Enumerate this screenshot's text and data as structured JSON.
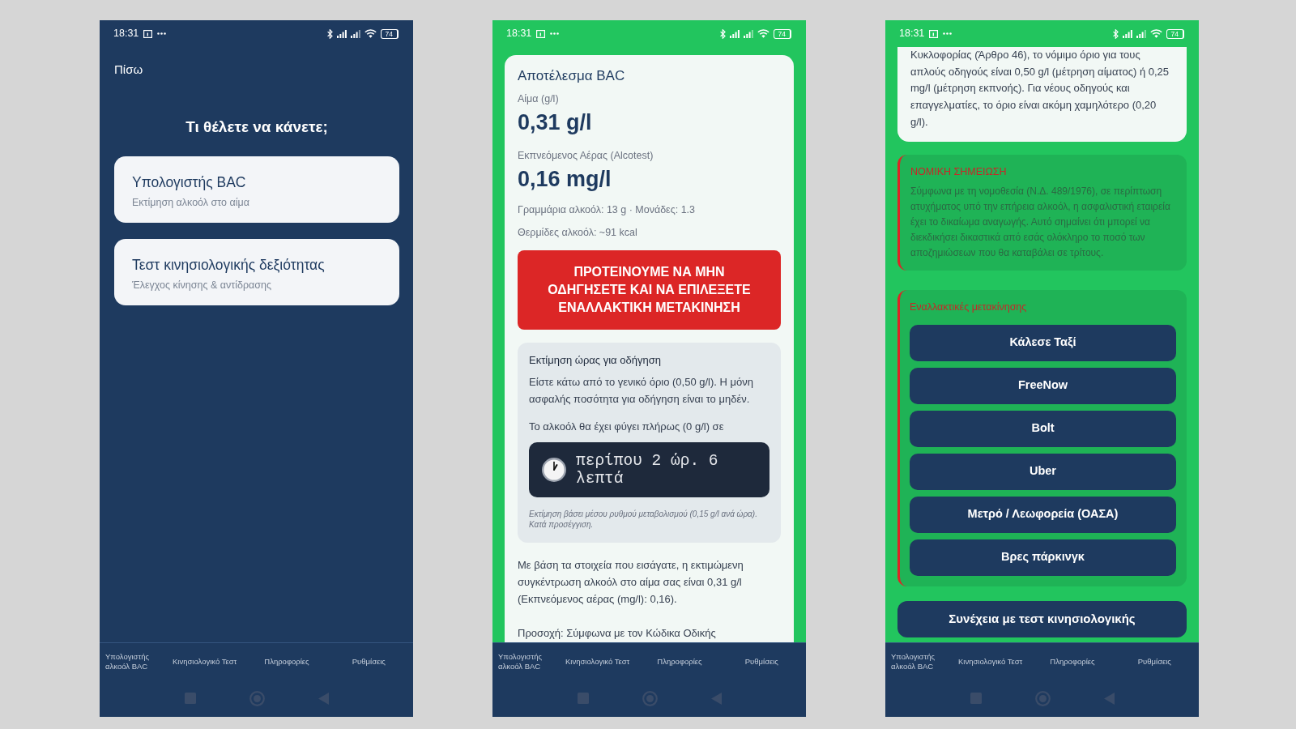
{
  "screens": [
    {
      "kind": "menu",
      "status_bar": {
        "time": "18:31",
        "battery": "74"
      },
      "blocks": [
        {
          "kind": "back_link",
          "text": "Πίσω"
        },
        {
          "kind": "heading",
          "text": "Τι θέλετε να κάνετε;"
        },
        {
          "kind": "option_card",
          "title": "Υπολογιστής BAC",
          "subtitle": "Εκτίμηση αλκοόλ στο αίμα"
        },
        {
          "kind": "option_card",
          "title": "Τεστ κινησιολογικής δεξιότητας",
          "subtitle": "Έλεγχος κίνησης & αντίδρασης"
        }
      ],
      "nav_tabs": [
        "Υπολογιστής αλκοόλ BAC",
        "Κινησιολογικό Τεστ",
        "Πληροφορίες",
        "Ρυθμίσεις"
      ]
    },
    {
      "kind": "result",
      "status_bar": {
        "time": "18:31",
        "battery": "74"
      },
      "blocks": [
        {
          "kind": "card",
          "items": [
            {
              "kind": "title",
              "text": "Αποτέλεσμα BAC"
            },
            {
              "kind": "label",
              "text": "Αίμα (g/l)"
            },
            {
              "kind": "value",
              "text": "0,31 g/l"
            },
            {
              "kind": "label",
              "text": "Εκπνεόμενος Αέρας (Alcotest)"
            },
            {
              "kind": "value",
              "text": "0,16 mg/l"
            },
            {
              "kind": "detail",
              "text": "Γραμμάρια αλκοόλ: 13 g · Μονάδες: 1.3"
            },
            {
              "kind": "detail",
              "text": "Θερμίδες αλκοόλ: ~91 kcal"
            },
            {
              "kind": "alert",
              "text": "ΠΡΟΤΕΙΝΟΥΜΕ ΝΑ ΜΗΝ ΟΔΗΓΗΣΕΤΕ ΚΑΙ ΝΑ ΕΠΙΛΕΞΕΤΕ ΕΝΑΛΛΑΚΤΙΚΗ ΜΕΤΑΚΙΝΗΣΗ"
            },
            {
              "kind": "estimate",
              "title": "Εκτίμηση ώρας για οδήγηση",
              "text": "Είστε κάτω από το γενικό όριο (0,50 g/l). Η μόνη ασφαλής ποσότητα για οδήγηση είναι το μηδέν.",
              "lead": "Το αλκοόλ θα έχει φύγει πλήρως (0 g/l) σε",
              "timer": "περίπου 2 ώρ. 6 λεπτά",
              "note": "Εκτίμηση βάσει μέσου ρυθμού μεταβολισμού (0,15 g/l ανά ώρα). Κατά προσέγγιση."
            },
            {
              "kind": "paragraph",
              "text": "Με βάση τα στοιχεία που εισάγατε, η εκτιμώμενη συγκέντρωση αλκοόλ στο αίμα σας είναι 0,31 g/l (Εκπνεόμενος αέρας (mg/l): 0,16)."
            },
            {
              "kind": "paragraph",
              "text": "Προσοχή: Σύμφωνα με τον Κώδικα Οδικής"
            }
          ]
        }
      ],
      "nav_tabs": [
        "Υπολογιστής αλκοόλ BAC",
        "Κινησιολογικό Τεστ",
        "Πληροφορίες",
        "Ρυθμίσεις"
      ]
    },
    {
      "kind": "result",
      "status_bar": {
        "time": "18:31",
        "battery": "74"
      },
      "blocks": [
        {
          "kind": "card_tail",
          "items": [
            {
              "kind": "paragraph",
              "text": "Κυκλοφορίας (Άρθρο 46), το νόμιμο όριο για τους απλούς οδηγούς είναι 0,50 g/l (μέτρηση αίματος) ή 0,25 mg/l (μέτρηση εκπνοής). Για νέους οδηγούς και επαγγελματίες, το όριο είναι ακόμη χαμηλότερο (0,20 g/l)."
            }
          ]
        },
        {
          "kind": "notice",
          "title": "ΝΟΜΙΚΗ ΣΗΜΕΙΩΣΗ",
          "text": "Σύμφωνα με τη νομοθεσία (Ν.Δ. 489/1976), σε περίπτωση ατυχήματος υπό την επήρεια αλκοόλ, η ασφαλιστική εταιρεία έχει το δικαίωμα αναγωγής. Αυτό σημαίνει ότι μπορεί να διεκδικήσει δικαστικά από εσάς ολόκληρο το ποσό των αποζημιώσεων που θα καταβάλει σε τρίτους."
        },
        {
          "kind": "alternatives",
          "title": "Εναλλακτικές μετακίνησης",
          "buttons": [
            "Κάλεσε Ταξί",
            "FreeNow",
            "Bolt",
            "Uber",
            "Μετρό / Λεωφορεία (ΟΑΣΑ)",
            "Βρες πάρκινγκ"
          ]
        },
        {
          "kind": "primary_button",
          "text": "Συνέχεια με τεστ κινησιολογικής"
        }
      ],
      "nav_tabs": [
        "Υπολογιστής αλκοόλ BAC",
        "Κινησιολογικό Τεστ",
        "Πληροφορίες",
        "Ρυθμίσεις"
      ]
    }
  ]
}
